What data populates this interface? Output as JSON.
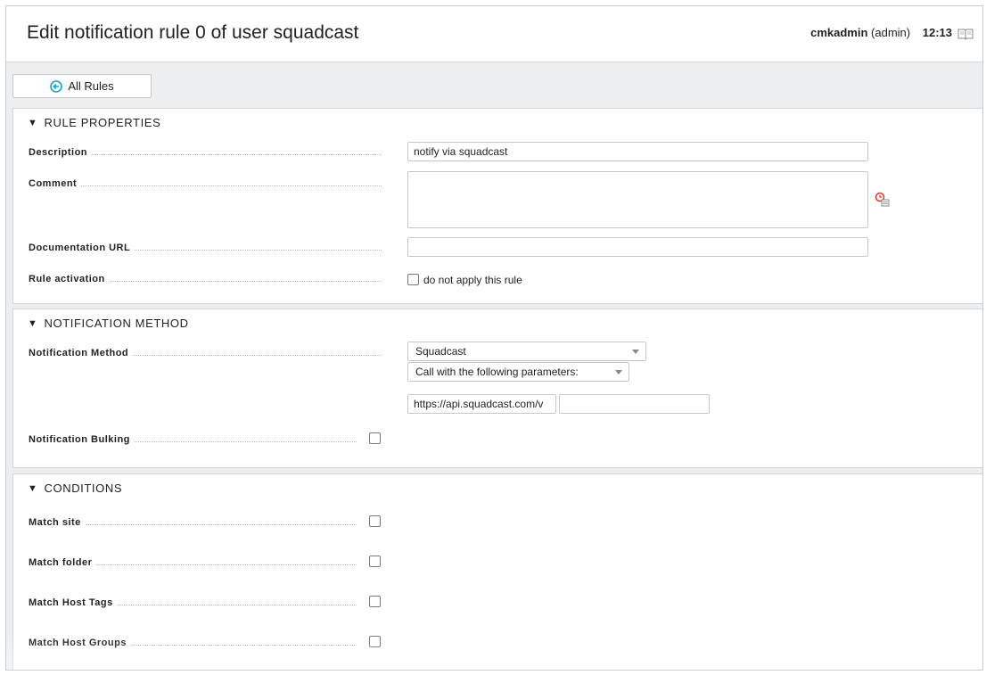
{
  "header": {
    "title": "Edit notification rule 0 of user squadcast",
    "username": "cmkadmin",
    "role": "(admin)",
    "time": "12:13"
  },
  "toolbar": {
    "all_rules_label": "All Rules"
  },
  "rule_properties": {
    "heading": "RULE PROPERTIES",
    "description_label": "Description",
    "description_value": "notify via squadcast",
    "comment_label": "Comment",
    "comment_value": "",
    "doc_url_label": "Documentation URL",
    "doc_url_value": "",
    "activation_label": "Rule activation",
    "activation_checkbox_label": "do not apply this rule"
  },
  "notification_method": {
    "heading": "NOTIFICATION METHOD",
    "method_label": "Notification Method",
    "method_selected": "Squadcast",
    "params_selected": "Call with the following parameters:",
    "param_value_1": "https://api.squadcast.com/v",
    "param_value_2": "",
    "bulking_label": "Notification Bulking"
  },
  "conditions": {
    "heading": "CONDITIONS",
    "items": [
      {
        "label": "Match site"
      },
      {
        "label": "Match folder"
      },
      {
        "label": "Match Host Tags"
      },
      {
        "label": "Match Host Groups"
      }
    ]
  },
  "colors": {
    "accent": "#13a5c8",
    "clock_icon": "#d9372b"
  }
}
